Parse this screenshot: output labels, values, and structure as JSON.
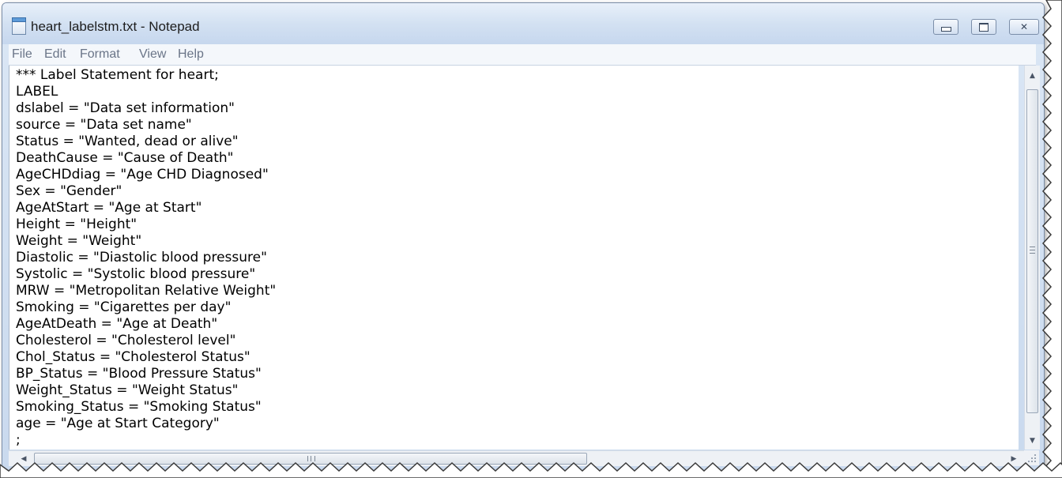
{
  "window": {
    "title": "heart_labelstm.txt - Notepad"
  },
  "icons": {
    "app": "notepad-icon",
    "minimize": "minimize-icon",
    "maximize": "maximize-icon",
    "close": "close-icon",
    "close_glyph": "✕"
  },
  "menu": {
    "file": "File",
    "edit": "Edit",
    "format": "Format",
    "view": "View",
    "help": "Help"
  },
  "editor": {
    "content": "*** Label Statement for heart;\nLABEL\ndslabel = \"Data set information\"\nsource = \"Data set name\"\nStatus = \"Wanted, dead or alive\"\nDeathCause = \"Cause of Death\"\nAgeCHDdiag = \"Age CHD Diagnosed\"\nSex = \"Gender\"\nAgeAtStart = \"Age at Start\"\nHeight = \"Height\"\nWeight = \"Weight\"\nDiastolic = \"Diastolic blood pressure\"\nSystolic = \"Systolic blood pressure\"\nMRW = \"Metropolitan Relative Weight\"\nSmoking = \"Cigarettes per day\"\nAgeAtDeath = \"Age at Death\"\nCholesterol = \"Cholesterol level\"\nChol_Status = \"Cholesterol Status\"\nBP_Status = \"Blood Pressure Status\"\nWeight_Status = \"Weight Status\"\nSmoking_Status = \"Smoking Status\"\nage = \"Age at Start Category\"\n;"
  },
  "scrollbars": {
    "up_arrow": "▲",
    "down_arrow": "▼",
    "left_arrow": "◀",
    "right_arrow": "▶"
  }
}
